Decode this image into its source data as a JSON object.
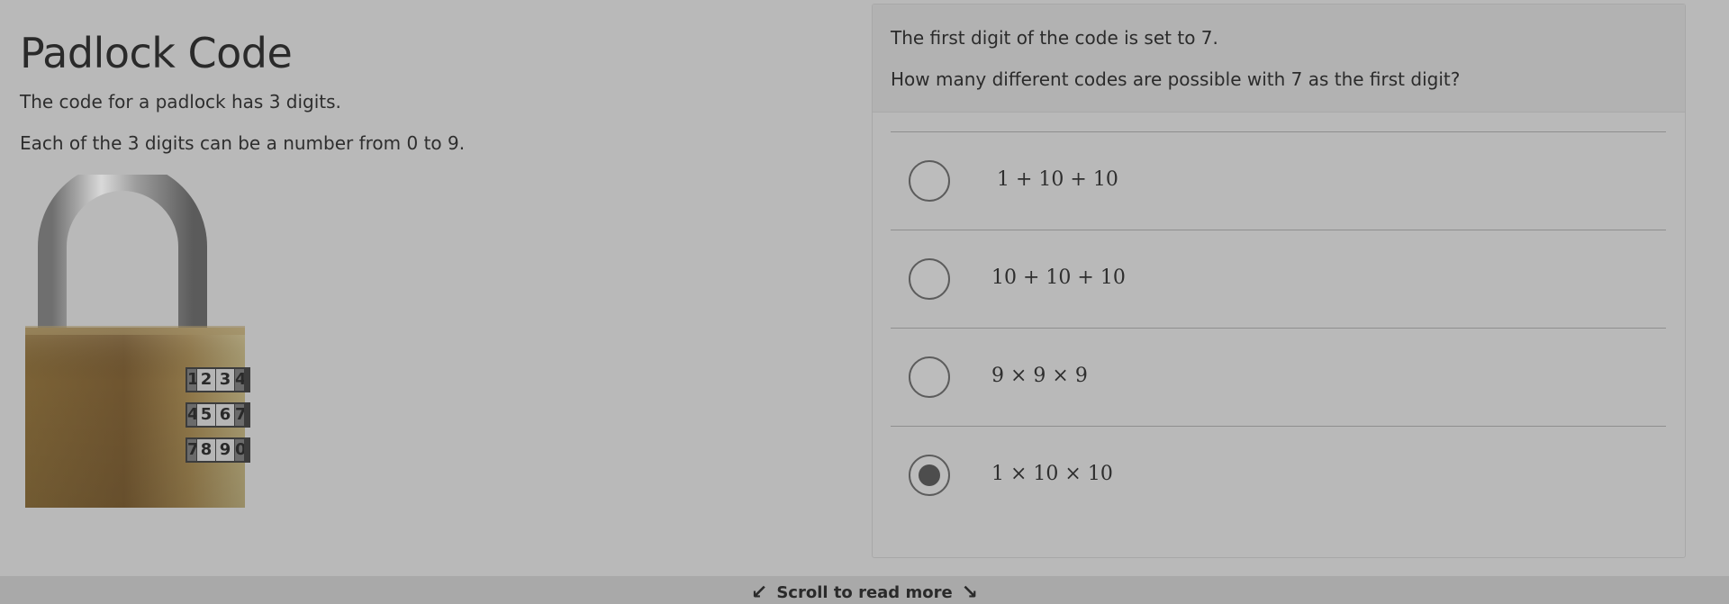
{
  "lesson": {
    "title": "Padlock Code",
    "intro": [
      "The code for a padlock has 3 digits.",
      "Each of the 3 digits can be a number from 0 to 9."
    ],
    "padlock_dials": [
      [
        "1",
        "2",
        "3",
        "4"
      ],
      [
        "4",
        "5",
        "6",
        "7"
      ],
      [
        "7",
        "8",
        "9",
        "0"
      ]
    ]
  },
  "question": {
    "lines": [
      "The first digit of the code is set to 7.",
      "How many different codes are possible with 7 as the first digit?"
    ],
    "options": [
      {
        "label": "1 + 10 + 10",
        "selected": false
      },
      {
        "label": "10 + 10 + 10",
        "selected": false
      },
      {
        "label": "9 × 9 × 9",
        "selected": false
      },
      {
        "label": "1 × 10 × 10",
        "selected": true
      }
    ]
  },
  "footer": {
    "scroll_label": "Scroll to read more",
    "left_arrow": "↙",
    "right_arrow": "↘"
  }
}
